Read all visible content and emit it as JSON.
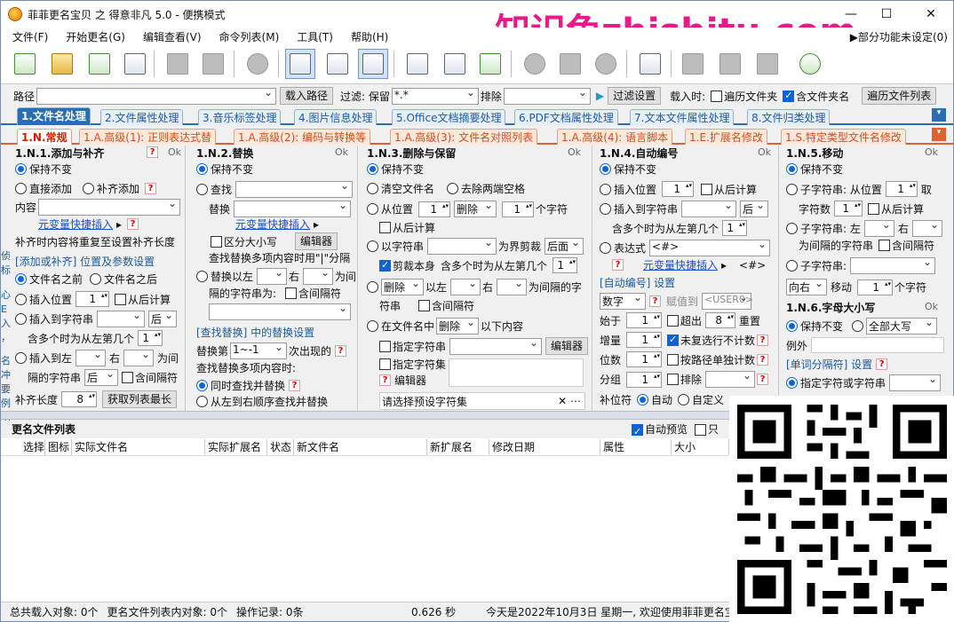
{
  "titlebar": {
    "title": "菲菲更名宝贝 之 得意非凡 5.0 - 便携模式"
  },
  "watermark": "知识兔zhishitu.com",
  "menu": [
    "文件(F)",
    "开始更名(G)",
    "编辑查看(V)",
    "命令列表(M)",
    "工具(T)",
    "帮助(H)"
  ],
  "menu_right": "▶部分功能未设定(0)",
  "pathbar": {
    "path_label": "路径",
    "load_btn": "载入路径",
    "filter_label": "过滤: 保留",
    "filter_value": "*.*",
    "exclude_label": "排除",
    "filter_settings": "过滤设置",
    "load_time_label": "载入时:",
    "sub_folder": "遍历文件夹",
    "include_folder": "含文件夹名",
    "traverse_list": "遍历文件列表"
  },
  "tabs1": [
    "1.文件名处理",
    "2.文件属性处理",
    "3.音乐标签处理",
    "4.图片信息处理",
    "5.Office文档摘要处理",
    "6.PDF文档属性处理",
    "7.文本文件属性处理",
    "8.文件归类处理"
  ],
  "tabs2": [
    "1.N.常规",
    "1.A.高级(1): 正则表达式替",
    "1.A.高级(2): 编码与转换等",
    "1.A.高级(3): 文件名对照列表",
    "1.A.高级(4): 语言脚本",
    "1.E.扩展名修改",
    "1.S.特定类型文件名修改"
  ],
  "p1": {
    "title": "1.N.1.添加与补齐",
    "ok": "Ok",
    "keep": "保持不变",
    "direct_add": "直接添加",
    "pad_add": "补齐添加",
    "content": "内容",
    "meta_insert": "元变量快捷插入",
    "pad_note": "补齐时内容将重复至设置补齐长度",
    "section": "[添加或补齐] 位置及参数设置",
    "before": "文件名之前",
    "after": "文件名之后",
    "insert_pos": "插入位置",
    "insert_pos_val": "1",
    "from_end": "从后计算",
    "insert_str": "插入到字符串",
    "back": "后",
    "match_note": "含多个时为从左第几个",
    "match_val": "1",
    "insert_lr": "插入到左",
    "right": "右",
    "as_gap": "为间",
    "gap_str": "隔的字符串",
    "back2": "后",
    "include_gap": "含间隔符",
    "pad_len": "补齐长度",
    "pad_val": "8",
    "get_max": "获取列表最长"
  },
  "p2": {
    "title": "1.N.2.替换",
    "ok": "Ok",
    "keep": "保持不变",
    "find": "查找",
    "replace": "替换",
    "meta_insert": "元变量快捷插入",
    "case": "区分大小写",
    "editor": "编辑器",
    "multi_note": "查找替换多项内容时用\"|\"分隔",
    "replace_lr": "替换以左",
    "right": "右",
    "as_gap": "为间",
    "gap_str": "隔的字符串为:",
    "include_gap": "含间隔符",
    "section": "[查找替换] 中的替换设置",
    "replace_nth": "替换第",
    "nth_val": "1~-1",
    "nth_suffix": "次出现的",
    "multi_q": "查找替换多项内容时:",
    "simul": "同时查找并替换",
    "seq": "从左到右顺序查找并替换"
  },
  "p3": {
    "title": "1.N.3.删除与保留",
    "ok": "Ok",
    "keep": "保持不变",
    "clear": "清空文件名",
    "trim": "去除两端空格",
    "from_pos": "从位置",
    "pos_val": "1",
    "delete": "删除",
    "cnt_val": "1",
    "chars": "个字符",
    "from_end": "从后计算",
    "by_str": "以字符串",
    "as_bound": "为界剪裁",
    "back": "后面",
    "cut_self": "剪裁本身",
    "multi_note": "含多个时为从左第几个",
    "multi_val": "1",
    "del2": "删除",
    "left_of": "以左",
    "right": "右",
    "gap_str": "为间隔的字",
    "str2": "符串",
    "include_gap": "含间隔符",
    "in_name": "在文件名中",
    "del3": "删除",
    "below": "以下内容",
    "spec_str": "指定字符串",
    "editor": "编辑器",
    "spec_set": "指定字符集",
    "editor2": "编辑器",
    "preset": "请选择预设字符集"
  },
  "p4": {
    "title": "1.N.4.自动编号",
    "ok": "Ok",
    "keep": "保持不变",
    "insert_pos": "插入位置",
    "pos_val": "1",
    "from_end": "从后计算",
    "insert_str": "插入到字符串",
    "back": "后",
    "multi_note": "含多个时为从左第几个",
    "multi_val": "1",
    "expr": "表达式",
    "expr_val": "<#>",
    "meta_insert": "元变量快捷插入",
    "tag": "<#>",
    "section": "[自动编号] 设置",
    "num": "数字",
    "assign": "赋值到",
    "user": "<USER0>",
    "start": "始于",
    "start_val": "1",
    "over": "超出",
    "over_val": "8",
    "reset": "重置",
    "step": "增量",
    "step_val": "1",
    "no_change": "未复选行不计数",
    "digits": "位数",
    "digits_val": "1",
    "by_path": "按路径单独计数",
    "group": "分组",
    "group_val": "1",
    "exclude": "排除",
    "pad_char": "补位符",
    "auto": "自动",
    "custom": "自定义"
  },
  "p5": {
    "title": "1.N.5.移动",
    "ok": "Ok",
    "keep": "保持不变",
    "sub_from": "子字符串: 从位置",
    "sub_from_val": "1",
    "take": "取",
    "char_count": "字符数",
    "char_val": "1",
    "from_end": "从后计算",
    "sub_left": "子字符串: 左",
    "right": "右",
    "gap_str": "为间隔的字符串",
    "include_gap": "含间隔符",
    "sub3": "子字符串:",
    "direction": "向右",
    "move": "移动",
    "move_val": "1",
    "chars": "个字符",
    "case_title": "1.N.6.字母大小写",
    "ok2": "Ok",
    "keep2": "保持不变",
    "all_upper": "全部大写",
    "except": "例外",
    "word_sep": "[单词分隔符] 设置",
    "spec": "指定字符或字符串"
  },
  "list": {
    "title": "更名文件列表",
    "auto_preview": "自动预览",
    "only": "只",
    "columns": [
      "选择",
      "图标",
      "实际文件名",
      "实际扩展名",
      "状态",
      "新文件名",
      "新扩展名",
      "修改日期",
      "属性",
      "大小"
    ]
  },
  "status": {
    "total": "总共载入对象: 0个",
    "in_list": "更名文件列表内对象: 0个",
    "ops": "操作记录: 0条",
    "time": "0.626 秒",
    "today": "今天是2022年10月3日 星期一, 欢迎使用菲菲更名宝"
  },
  "side_text": [
    "侦",
    "标",
    "心",
    "E",
    "入",
    "，",
    "名",
    "冲",
    "要",
    "例",
    "功"
  ]
}
